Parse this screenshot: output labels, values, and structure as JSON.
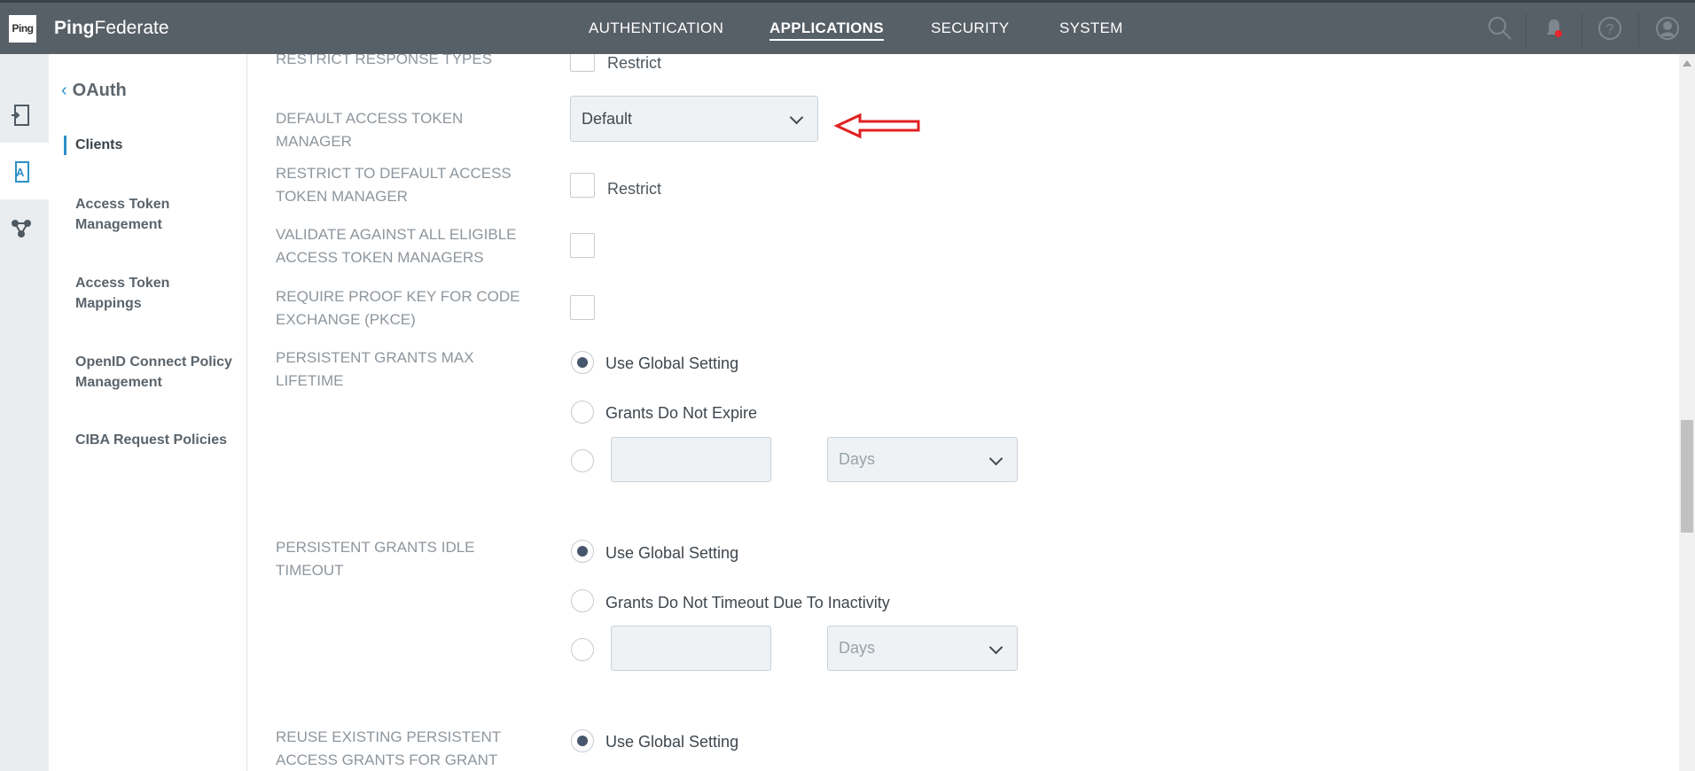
{
  "app": {
    "logo_text": "Ping",
    "brand_bold": "Ping",
    "brand_light": "Federate"
  },
  "topnav": {
    "items": [
      {
        "label": "AUTHENTICATION",
        "active": false
      },
      {
        "label": "APPLICATIONS",
        "active": true
      },
      {
        "label": "SECURITY",
        "active": false
      },
      {
        "label": "SYSTEM",
        "active": false
      }
    ],
    "icons": [
      "search-icon",
      "notification-bell-icon",
      "help-icon",
      "user-profile-icon"
    ],
    "notification_dot_color": "#e8262b"
  },
  "rail": {
    "items": [
      "token-exchange-icon",
      "applications-icon",
      "integration-icon"
    ],
    "accent": "#2e8fc8"
  },
  "subnav": {
    "back_label": "OAuth",
    "items": [
      {
        "label": "Clients",
        "selected": true
      },
      {
        "label": "Access Token Management",
        "selected": false
      },
      {
        "label": "Access Token Mappings",
        "selected": false
      },
      {
        "label": "OpenID Connect Policy Management",
        "selected": false
      },
      {
        "label": "CIBA Request Policies",
        "selected": false
      }
    ]
  },
  "form": {
    "restrict_response_types": {
      "label": "RESTRICT RESPONSE TYPES",
      "checkbox_text": "Restrict",
      "checked": false
    },
    "default_atm": {
      "label": "DEFAULT ACCESS TOKEN MANAGER",
      "value": "Default"
    },
    "restrict_default_atm": {
      "label": "RESTRICT TO DEFAULT ACCESS TOKEN MANAGER",
      "checkbox_text": "Restrict",
      "checked": false
    },
    "validate_all": {
      "label": "VALIDATE AGAINST ALL ELIGIBLE ACCESS TOKEN MANAGERS",
      "checked": false
    },
    "pkce": {
      "label": "REQUIRE PROOF KEY FOR CODE EXCHANGE (PKCE)",
      "checked": false
    },
    "grants_max_lifetime": {
      "label": "PERSISTENT GRANTS MAX LIFETIME",
      "options": [
        "Use Global Setting",
        "Grants Do Not Expire"
      ],
      "selected": 0,
      "custom_value": "",
      "unit": "Days"
    },
    "grants_idle_timeout": {
      "label": "PERSISTENT GRANTS IDLE TIMEOUT",
      "options": [
        "Use Global Setting",
        "Grants Do Not Timeout Due To Inactivity"
      ],
      "selected": 0,
      "custom_value": "",
      "unit": "Days"
    },
    "reuse_grants": {
      "label": "REUSE EXISTING PERSISTENT ACCESS GRANTS FOR GRANT",
      "options": [
        "Use Global Setting"
      ],
      "selected": 0
    }
  },
  "annotation_arrow_color": "#e02020"
}
